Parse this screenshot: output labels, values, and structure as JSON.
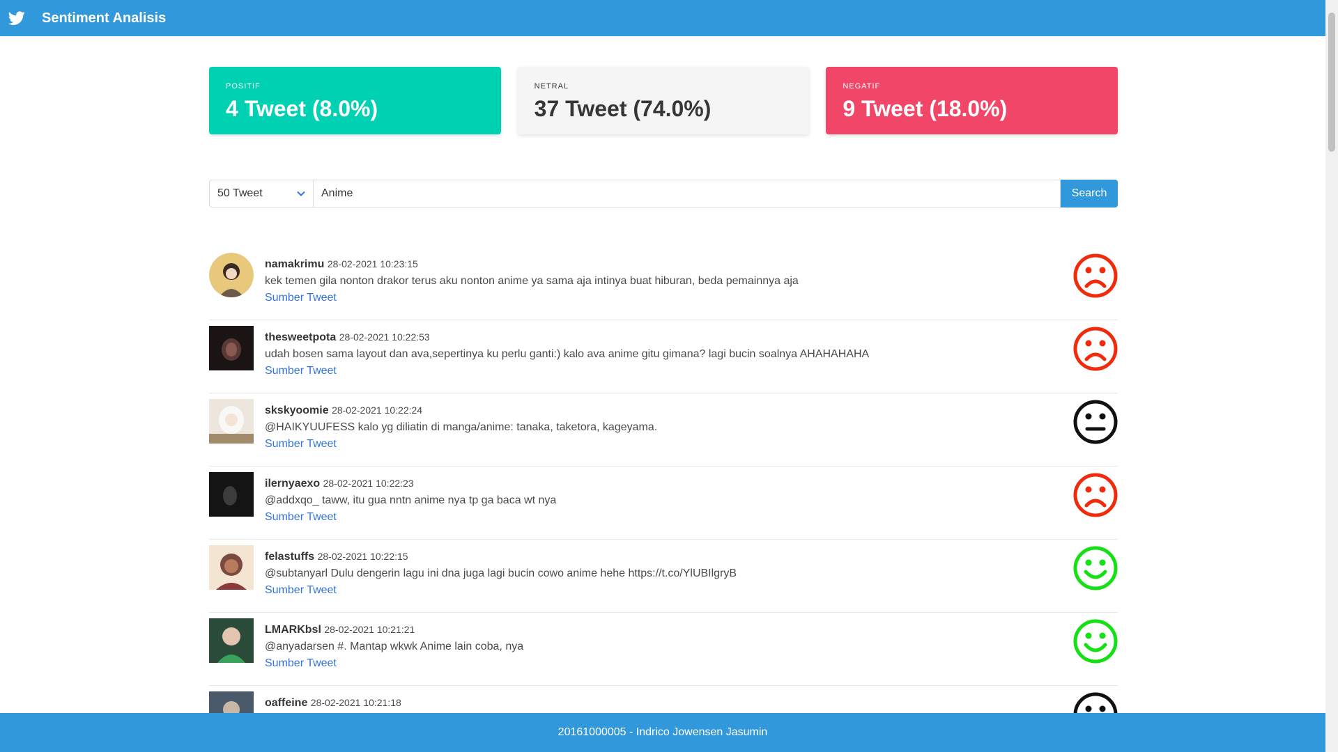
{
  "nav": {
    "title": "Sentiment Analisis",
    "icon": "twitter-bird-icon"
  },
  "stats": {
    "positive": {
      "heading": "POSITIF",
      "value": "4 Tweet (8.0%)",
      "color": "#00d1b2"
    },
    "neutral": {
      "heading": "NETRAL",
      "value": "37 Tweet (74.0%)",
      "color": "#f5f5f5"
    },
    "negative": {
      "heading": "NEGATIF",
      "value": "9 Tweet (18.0%)",
      "color": "#f14668"
    }
  },
  "search": {
    "count_selected": "50 Tweet",
    "query": "Anime",
    "button_label": "Search"
  },
  "tweets": [
    {
      "user": "namakrimu",
      "time": "28-02-2021 10:23:15",
      "text": "kek temen gila nonton drakor terus aku nonton anime ya sama aja intinya buat hiburan, beda pemainnya aja",
      "link": "Sumber Tweet",
      "sentiment": "negative"
    },
    {
      "user": "thesweetpota",
      "time": "28-02-2021 10:22:53",
      "text": "udah bosen sama layout dan ava,sepertinya ku perlu ganti:) kalo ava anime gitu gimana? lagi bucin soalnya AHAHAHAHA",
      "link": "Sumber Tweet",
      "sentiment": "negative"
    },
    {
      "user": "skskyoomie",
      "time": "28-02-2021 10:22:24",
      "text": "@HAIKYUUFESS kalo yg diliatin di manga/anime: tanaka, taketora, kageyama.",
      "link": "Sumber Tweet",
      "sentiment": "neutral"
    },
    {
      "user": "ilernyaexo",
      "time": "28-02-2021 10:22:23",
      "text": "@addxqo_ taww, itu gua nntn anime nya tp ga baca wt nya",
      "link": "Sumber Tweet",
      "sentiment": "negative"
    },
    {
      "user": "felastuffs",
      "time": "28-02-2021 10:22:15",
      "text": "@subtanyarl Dulu dengerin lagu ini dna juga lagi bucin cowo anime hehe https://t.co/YlUBIlgryB",
      "link": "Sumber Tweet",
      "sentiment": "positive"
    },
    {
      "user": "LMARKbsl",
      "time": "28-02-2021 10:21:21",
      "text": "@anyadarsen #. Mantap wkwk Anime lain coba, nya",
      "link": "Sumber Tweet",
      "sentiment": "positive"
    },
    {
      "user": "oaffeine",
      "time": "28-02-2021 10:21:18",
      "text": "",
      "link": "",
      "sentiment": "neutral"
    }
  ],
  "colors": {
    "positive": "#15e015",
    "neutral": "#111111",
    "negative": "#f02a0a",
    "brand": "#3298dc"
  },
  "footer": {
    "text": "20161000005 - Indrico Jowensen Jasumin"
  }
}
